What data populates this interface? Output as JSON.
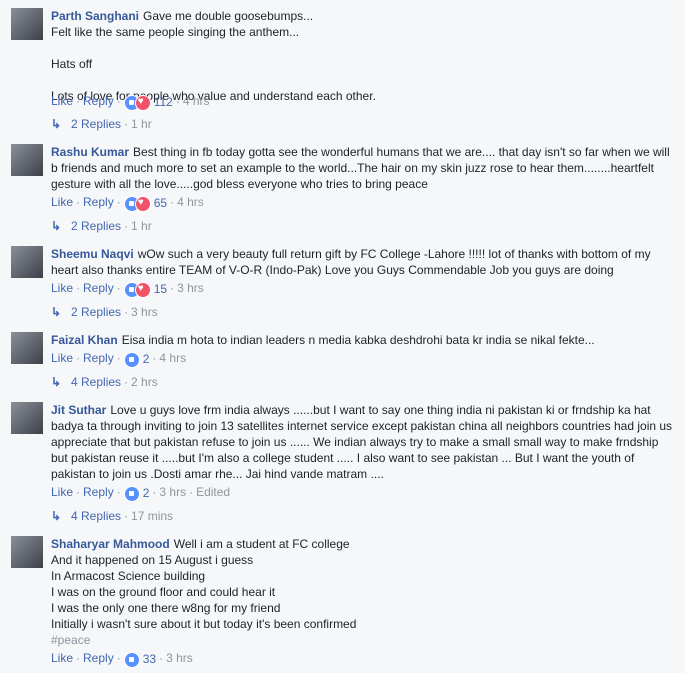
{
  "comments": [
    {
      "name": "Parth Sanghani",
      "text": "Gave me double goosebumps...\nFelt like the same people singing the anthem...\n\nHats off\n\nLots of love for people who value and understand each other.",
      "like": "Like",
      "reply": "Reply",
      "count": "112",
      "time": "4 hrs",
      "replies": "2 Replies",
      "replies_time": "1 hr"
    },
    {
      "name": "Rashu Kumar",
      "text": "Best thing in fb today gotta see the wonderful humans that we are.... that day isn't so far when we will b friends and much more to set an example to the world...The hair on my skin juzz rose to hear them........heartfelt gesture with all the love.....god bless everyone who tries to bring peace",
      "like": "Like",
      "reply": "Reply",
      "count": "65",
      "time": "4 hrs",
      "replies": "2 Replies",
      "replies_time": "1 hr"
    },
    {
      "name": "Sheemu Naqvi",
      "text": "wOw such a very beauty full return gift by FC College -Lahore !!!!! lot of thanks with bottom of my heart also thanks entire TEAM of V-O-R (Indo-Pak) Love you Guys Commendable Job you guys are doing",
      "like": "Like",
      "reply": "Reply",
      "count": "15",
      "time": "3 hrs",
      "replies": "2 Replies",
      "replies_time": "3 hrs"
    },
    {
      "name": "Faizal Khan",
      "text": "Eisa india m hota to indian leaders n media kabka deshdrohi bata kr india se nikal fekte...",
      "like": "Like",
      "reply": "Reply",
      "count": "2",
      "time": "4 hrs",
      "replies": "4 Replies",
      "replies_time": "2 hrs"
    },
    {
      "name": "Jit Suthar",
      "text": "Love u guys love frm india always ......but I want to say one thing india ni pakistan ki or frndship ka hat badya ta through inviting to join 13 satellites internet service except pakistan china all neighbors countries had join us appreciate that but pakistan refuse to join us ...... We indian always try to make a small small way to make frndship but pakistan reuse it .....but I'm also a college student ..... I also want to see pakistan ... But I want the youth of pakistan to join us .Dosti amar rhe... Jai hind vande matram ....",
      "like": "Like",
      "reply": "Reply",
      "count": "2",
      "time": "3 hrs",
      "edited": "Edited",
      "replies": "4 Replies",
      "replies_time": "17 mins"
    },
    {
      "name": "Shaharyar Mahmood",
      "text": "Well i am a student at FC college\nAnd it happened on 15 August i guess\nIn Armacost Science building\nI was on the ground floor and could hear it\nI was the only one there w8ng for my friend\nInitially i wasn't sure about it but today it's been confirmed",
      "hashtag": "#peace",
      "like": "Like",
      "reply": "Reply",
      "count": "33",
      "time": "3 hrs"
    }
  ],
  "separator": "·"
}
